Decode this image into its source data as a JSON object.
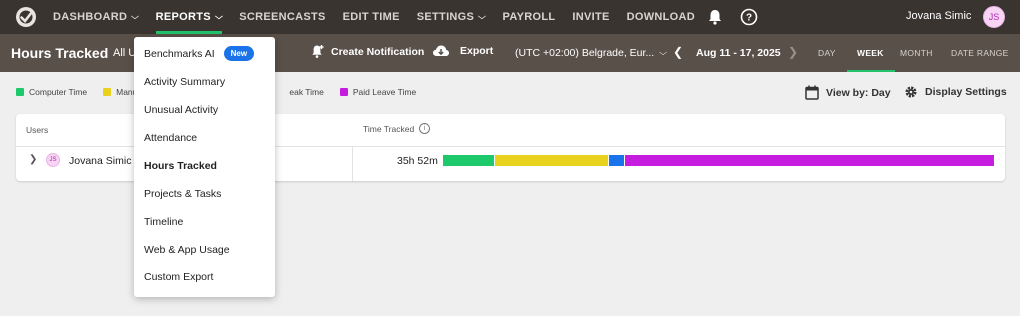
{
  "nav": {
    "items": [
      {
        "label": "DASHBOARD",
        "chevron": true
      },
      {
        "label": "REPORTS",
        "chevron": true,
        "active": true
      },
      {
        "label": "SCREENCASTS",
        "chevron": false
      },
      {
        "label": "EDIT TIME",
        "chevron": false
      },
      {
        "label": "SETTINGS",
        "chevron": true
      },
      {
        "label": "PAYROLL",
        "chevron": false
      },
      {
        "label": "INVITE",
        "chevron": false
      },
      {
        "label": "DOWNLOAD",
        "chevron": false
      }
    ],
    "user_name": "Jovana Simic",
    "user_initials": "JS",
    "accent": "#21c36b"
  },
  "subbar": {
    "title": "Hours Tracked",
    "all_users": "All U",
    "create_notification": "Create Notification",
    "export": "Export",
    "timezone": "(UTC +02:00) Belgrade, Eur...",
    "date_range": "Aug 11 - 17, 2025",
    "periods": [
      "DAY",
      "WEEK",
      "MONTH",
      "DATE RANGE"
    ],
    "active_period": "WEEK"
  },
  "legend": [
    {
      "label": "Computer Time",
      "color": "#1ec96b"
    },
    {
      "label": "Manu",
      "color": "#e8d21e"
    },
    {
      "label": "eak Time",
      "color": "#1a73e8"
    },
    {
      "label": "Paid Leave Time",
      "color": "#c61ce0"
    }
  ],
  "controls": {
    "view_by": "View by: Day",
    "display_settings": "Display Settings"
  },
  "table": {
    "headers": {
      "users": "Users",
      "time_tracked": "Time Tracked"
    },
    "rows": [
      {
        "user": "Jovana Simic",
        "initials": "JS",
        "total": "35h 52m",
        "segments": [
          {
            "type": "Computer Time",
            "fraction": 0.092,
            "color": "#1ec96b"
          },
          {
            "type": "Manual Time",
            "fraction": 0.208,
            "color": "#e8d21e"
          },
          {
            "type": "Break Time",
            "fraction": 0.028,
            "color": "#1a73e8"
          },
          {
            "type": "Paid Leave Time",
            "fraction": 0.672,
            "color": "#c61ce0"
          }
        ]
      }
    ]
  },
  "reports_menu": {
    "items": [
      {
        "label": "Benchmarks AI",
        "badge": "New"
      },
      {
        "label": "Activity Summary"
      },
      {
        "label": "Unusual Activity"
      },
      {
        "label": "Attendance"
      },
      {
        "label": "Hours Tracked",
        "active": true
      },
      {
        "label": "Projects & Tasks"
      },
      {
        "label": "Timeline"
      },
      {
        "label": "Web & App Usage"
      },
      {
        "label": "Custom Export"
      }
    ]
  }
}
